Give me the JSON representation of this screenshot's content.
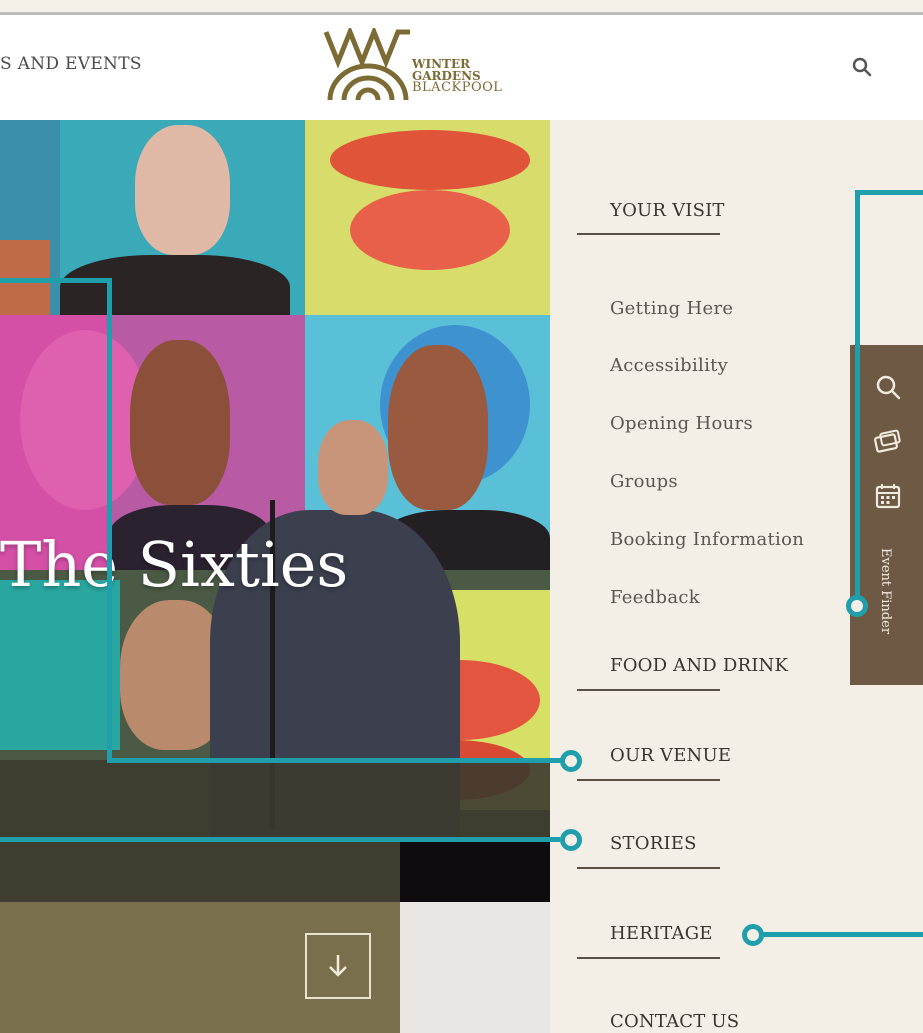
{
  "header": {
    "nav_left_text": "S AND EVENTS",
    "logo": {
      "line1": "WINTER",
      "line2": "GARDENS",
      "line3": "BLACKPOOL"
    }
  },
  "hero": {
    "title": "The Sixties"
  },
  "menu": {
    "your_visit": {
      "heading": "YOUR VISIT",
      "items": [
        "Getting Here",
        "Accessibility",
        "Opening Hours",
        "Groups",
        "Booking Information",
        "Feedback"
      ]
    },
    "food_and_drink": "FOOD AND DRINK",
    "our_venue": "OUR VENUE",
    "stories": "STORIES",
    "heritage": "HERITAGE",
    "contact_us": "CONTACT US"
  },
  "event_finder": {
    "label": "Event Finder",
    "icons": [
      "search-icon",
      "ticket-icon",
      "calendar-icon"
    ]
  },
  "colors": {
    "accent_teal": "#1f9fab",
    "logo_gold": "#7d6b35",
    "sidebar_brown": "#6e5a44",
    "menu_bg": "#f3eee6"
  }
}
